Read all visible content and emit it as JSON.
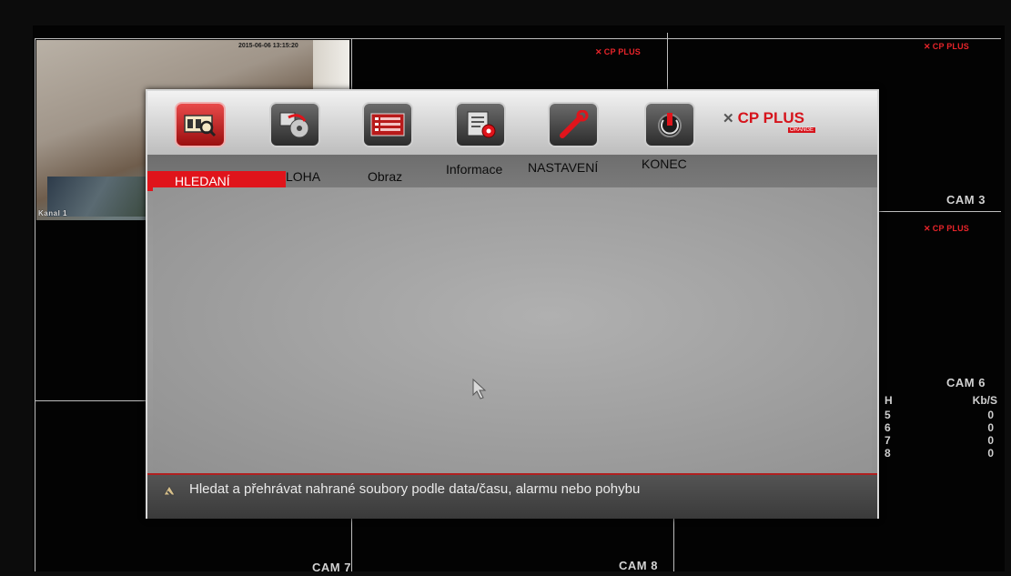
{
  "menu": {
    "items": [
      {
        "label": "HLEDANÍ",
        "icon": "search-film-icon",
        "active": true
      },
      {
        "label": "LOHA",
        "icon": "backup-disc-icon",
        "active": false
      },
      {
        "label": "Obraz",
        "icon": "display-list-icon",
        "active": false
      },
      {
        "label": "Informace",
        "icon": "info-settings-icon",
        "active": false
      },
      {
        "label": "NASTAVENÍ",
        "icon": "wrench-icon",
        "active": false
      },
      {
        "label": "KONEC",
        "icon": "power-icon",
        "active": false
      }
    ],
    "brand": "CP PLUS",
    "brand_sub": "ORANGE",
    "status_text": "Hledat a přehrávat nahrané soubory podle data/času, alarmu nebo pohybu"
  },
  "cameras": {
    "timestamp": "2015-06-06 13:15:20",
    "cam1_label": "Kanal 1",
    "logo": "CP PLUS",
    "cam3": "CAM 3",
    "cam6": "CAM 6",
    "cam7": "CAM 7",
    "cam8": "CAM 8"
  },
  "stats": {
    "col_ch": "H",
    "col_rate": "Kb/S",
    "rows": [
      {
        "ch": "5",
        "rate": "0"
      },
      {
        "ch": "6",
        "rate": "0"
      },
      {
        "ch": "7",
        "rate": "0"
      },
      {
        "ch": "8",
        "rate": "0"
      }
    ]
  },
  "colors": {
    "accent_red": "#e0141b",
    "brand_red": "#d6141c"
  }
}
